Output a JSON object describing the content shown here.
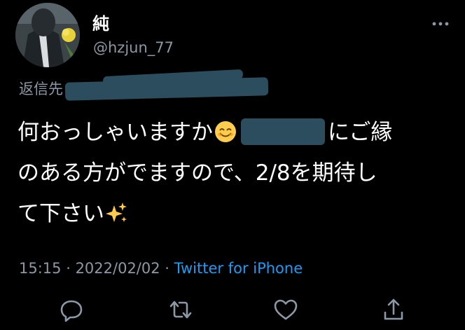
{
  "user": {
    "display_name": "純",
    "handle": "@hzjun_77"
  },
  "reply": {
    "label": "返信先"
  },
  "tweet": {
    "line1_a": "何おっしゃいますか",
    "line1_b": "にご縁",
    "line2": "のある方がでますので、2/8を期待し",
    "line3": "て下さい"
  },
  "meta": {
    "time": "15:15",
    "separator": " · ",
    "date": "2022/02/02",
    "source": "Twitter for iPhone"
  },
  "icons": {
    "more": "more-dots-icon",
    "reply": "reply-icon",
    "retweet": "retweet-icon",
    "like": "heart-icon",
    "share": "share-icon",
    "smile": "smiling-face-emoji",
    "sparkles": "sparkles-emoji"
  },
  "colors": {
    "background": "#000000",
    "text": "#ffffff",
    "secondary": "#8b98a5",
    "link": "#1d9bf0",
    "redaction": "#2b4d5d"
  }
}
